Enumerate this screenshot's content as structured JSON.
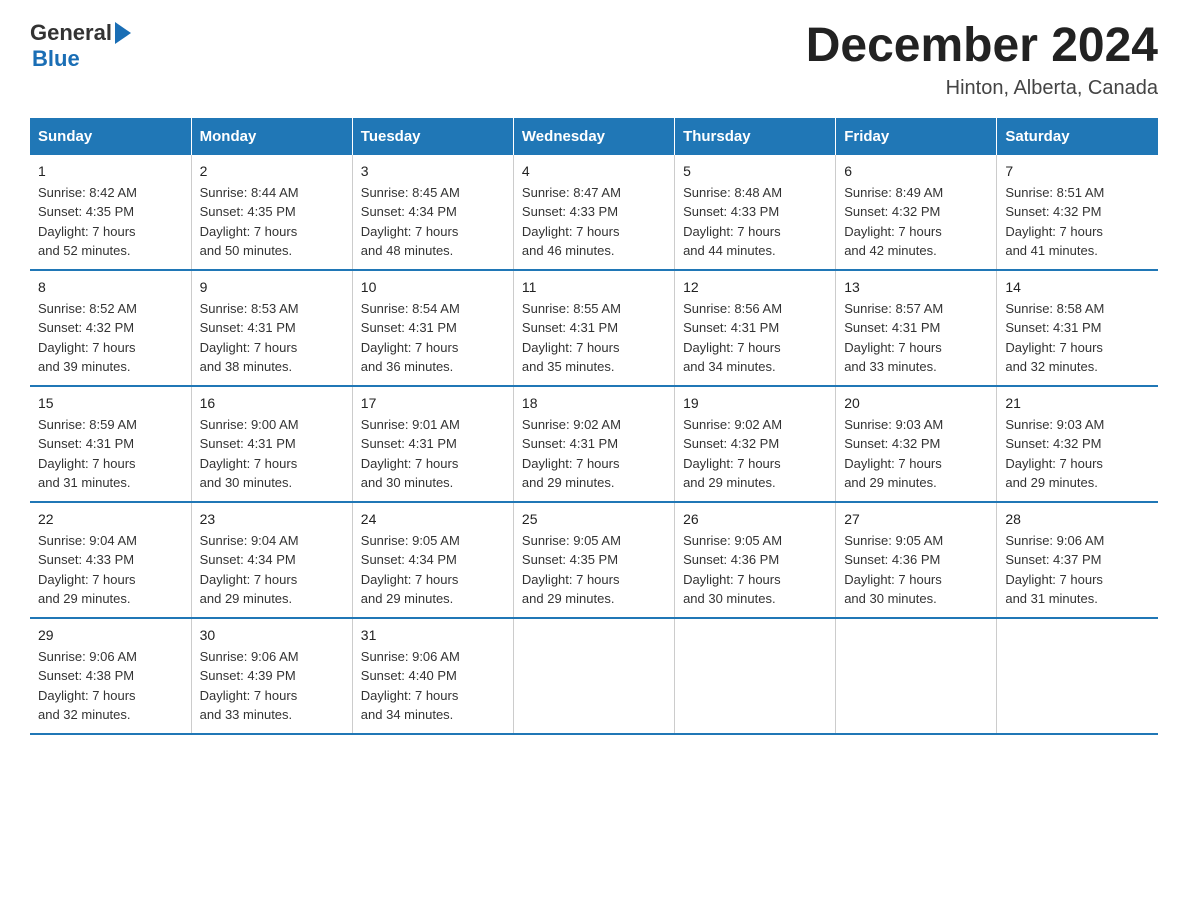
{
  "logo": {
    "text_general": "General",
    "text_blue": "Blue",
    "arrow": "▶"
  },
  "title": "December 2024",
  "subtitle": "Hinton, Alberta, Canada",
  "days_of_week": [
    "Sunday",
    "Monday",
    "Tuesday",
    "Wednesday",
    "Thursday",
    "Friday",
    "Saturday"
  ],
  "weeks": [
    [
      {
        "day": "1",
        "info": "Sunrise: 8:42 AM\nSunset: 4:35 PM\nDaylight: 7 hours\nand 52 minutes."
      },
      {
        "day": "2",
        "info": "Sunrise: 8:44 AM\nSunset: 4:35 PM\nDaylight: 7 hours\nand 50 minutes."
      },
      {
        "day": "3",
        "info": "Sunrise: 8:45 AM\nSunset: 4:34 PM\nDaylight: 7 hours\nand 48 minutes."
      },
      {
        "day": "4",
        "info": "Sunrise: 8:47 AM\nSunset: 4:33 PM\nDaylight: 7 hours\nand 46 minutes."
      },
      {
        "day": "5",
        "info": "Sunrise: 8:48 AM\nSunset: 4:33 PM\nDaylight: 7 hours\nand 44 minutes."
      },
      {
        "day": "6",
        "info": "Sunrise: 8:49 AM\nSunset: 4:32 PM\nDaylight: 7 hours\nand 42 minutes."
      },
      {
        "day": "7",
        "info": "Sunrise: 8:51 AM\nSunset: 4:32 PM\nDaylight: 7 hours\nand 41 minutes."
      }
    ],
    [
      {
        "day": "8",
        "info": "Sunrise: 8:52 AM\nSunset: 4:32 PM\nDaylight: 7 hours\nand 39 minutes."
      },
      {
        "day": "9",
        "info": "Sunrise: 8:53 AM\nSunset: 4:31 PM\nDaylight: 7 hours\nand 38 minutes."
      },
      {
        "day": "10",
        "info": "Sunrise: 8:54 AM\nSunset: 4:31 PM\nDaylight: 7 hours\nand 36 minutes."
      },
      {
        "day": "11",
        "info": "Sunrise: 8:55 AM\nSunset: 4:31 PM\nDaylight: 7 hours\nand 35 minutes."
      },
      {
        "day": "12",
        "info": "Sunrise: 8:56 AM\nSunset: 4:31 PM\nDaylight: 7 hours\nand 34 minutes."
      },
      {
        "day": "13",
        "info": "Sunrise: 8:57 AM\nSunset: 4:31 PM\nDaylight: 7 hours\nand 33 minutes."
      },
      {
        "day": "14",
        "info": "Sunrise: 8:58 AM\nSunset: 4:31 PM\nDaylight: 7 hours\nand 32 minutes."
      }
    ],
    [
      {
        "day": "15",
        "info": "Sunrise: 8:59 AM\nSunset: 4:31 PM\nDaylight: 7 hours\nand 31 minutes."
      },
      {
        "day": "16",
        "info": "Sunrise: 9:00 AM\nSunset: 4:31 PM\nDaylight: 7 hours\nand 30 minutes."
      },
      {
        "day": "17",
        "info": "Sunrise: 9:01 AM\nSunset: 4:31 PM\nDaylight: 7 hours\nand 30 minutes."
      },
      {
        "day": "18",
        "info": "Sunrise: 9:02 AM\nSunset: 4:31 PM\nDaylight: 7 hours\nand 29 minutes."
      },
      {
        "day": "19",
        "info": "Sunrise: 9:02 AM\nSunset: 4:32 PM\nDaylight: 7 hours\nand 29 minutes."
      },
      {
        "day": "20",
        "info": "Sunrise: 9:03 AM\nSunset: 4:32 PM\nDaylight: 7 hours\nand 29 minutes."
      },
      {
        "day": "21",
        "info": "Sunrise: 9:03 AM\nSunset: 4:32 PM\nDaylight: 7 hours\nand 29 minutes."
      }
    ],
    [
      {
        "day": "22",
        "info": "Sunrise: 9:04 AM\nSunset: 4:33 PM\nDaylight: 7 hours\nand 29 minutes."
      },
      {
        "day": "23",
        "info": "Sunrise: 9:04 AM\nSunset: 4:34 PM\nDaylight: 7 hours\nand 29 minutes."
      },
      {
        "day": "24",
        "info": "Sunrise: 9:05 AM\nSunset: 4:34 PM\nDaylight: 7 hours\nand 29 minutes."
      },
      {
        "day": "25",
        "info": "Sunrise: 9:05 AM\nSunset: 4:35 PM\nDaylight: 7 hours\nand 29 minutes."
      },
      {
        "day": "26",
        "info": "Sunrise: 9:05 AM\nSunset: 4:36 PM\nDaylight: 7 hours\nand 30 minutes."
      },
      {
        "day": "27",
        "info": "Sunrise: 9:05 AM\nSunset: 4:36 PM\nDaylight: 7 hours\nand 30 minutes."
      },
      {
        "day": "28",
        "info": "Sunrise: 9:06 AM\nSunset: 4:37 PM\nDaylight: 7 hours\nand 31 minutes."
      }
    ],
    [
      {
        "day": "29",
        "info": "Sunrise: 9:06 AM\nSunset: 4:38 PM\nDaylight: 7 hours\nand 32 minutes."
      },
      {
        "day": "30",
        "info": "Sunrise: 9:06 AM\nSunset: 4:39 PM\nDaylight: 7 hours\nand 33 minutes."
      },
      {
        "day": "31",
        "info": "Sunrise: 9:06 AM\nSunset: 4:40 PM\nDaylight: 7 hours\nand 34 minutes."
      },
      {
        "day": "",
        "info": ""
      },
      {
        "day": "",
        "info": ""
      },
      {
        "day": "",
        "info": ""
      },
      {
        "day": "",
        "info": ""
      }
    ]
  ]
}
